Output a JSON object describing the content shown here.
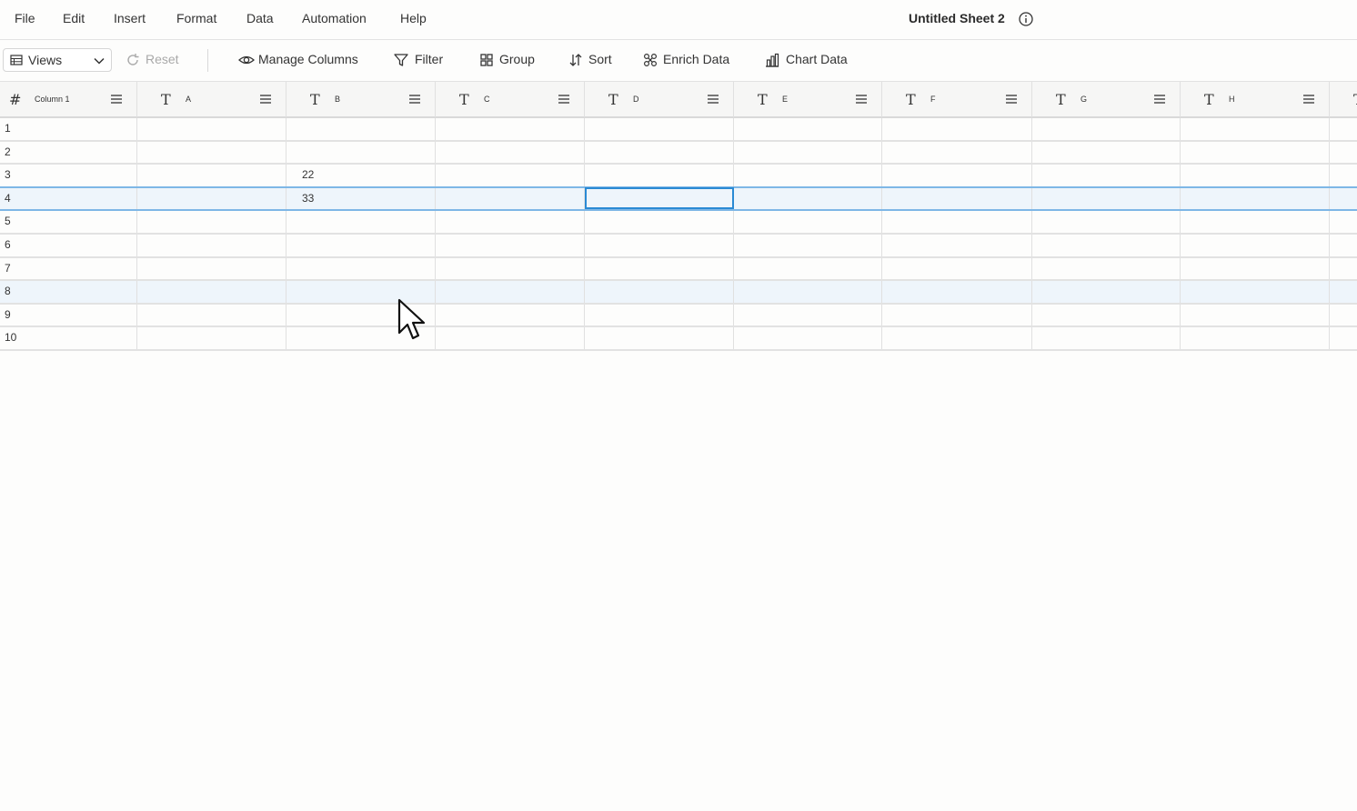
{
  "menu": {
    "items": [
      "File",
      "Edit",
      "Insert",
      "Format",
      "Data",
      "Automation",
      "Help"
    ]
  },
  "sheet": {
    "title": "Untitled Sheet 2",
    "info_icon": "info-icon"
  },
  "toolbar": {
    "views": "Views",
    "reset": "Reset",
    "manage_columns": "Manage Columns",
    "filter": "Filter",
    "group": "Group",
    "sort": "Sort",
    "enrich": "Enrich Data",
    "chart": "Chart Data"
  },
  "grid": {
    "columns": [
      {
        "name": "Column 1",
        "type": "number"
      },
      {
        "name": "A",
        "type": "text"
      },
      {
        "name": "B",
        "type": "text"
      },
      {
        "name": "C",
        "type": "text"
      },
      {
        "name": "D",
        "type": "text"
      },
      {
        "name": "E",
        "type": "text"
      },
      {
        "name": "F",
        "type": "text"
      },
      {
        "name": "G",
        "type": "text"
      },
      {
        "name": "H",
        "type": "text"
      }
    ],
    "rows": [
      {
        "num": "1",
        "cells": [
          "",
          "",
          "",
          "",
          "",
          "",
          "",
          "",
          ""
        ]
      },
      {
        "num": "2",
        "cells": [
          "",
          "",
          "",
          "",
          "",
          "",
          "",
          "",
          ""
        ]
      },
      {
        "num": "3",
        "cells": [
          "",
          "",
          "22",
          "",
          "",
          "",
          "",
          "",
          ""
        ]
      },
      {
        "num": "4",
        "cells": [
          "",
          "",
          "33",
          "",
          "",
          "",
          "",
          "",
          ""
        ]
      },
      {
        "num": "5",
        "cells": [
          "",
          "",
          "",
          "",
          "",
          "",
          "",
          "",
          ""
        ]
      },
      {
        "num": "6",
        "cells": [
          "",
          "",
          "",
          "",
          "",
          "",
          "",
          "",
          ""
        ]
      },
      {
        "num": "7",
        "cells": [
          "",
          "",
          "",
          "",
          "",
          "",
          "",
          "",
          ""
        ]
      },
      {
        "num": "8",
        "cells": [
          "",
          "",
          "",
          "",
          "",
          "",
          "",
          "",
          ""
        ]
      },
      {
        "num": "9",
        "cells": [
          "",
          "",
          "",
          "",
          "",
          "",
          "",
          "",
          ""
        ]
      },
      {
        "num": "10",
        "cells": [
          "",
          "",
          "",
          "",
          "",
          "",
          "",
          "",
          ""
        ]
      }
    ],
    "selected_row": "4",
    "active_cell": "D4",
    "hover_row": "8"
  },
  "colors": {
    "accent": "#2a8ad4",
    "selection_bg": "#eef5fb"
  }
}
